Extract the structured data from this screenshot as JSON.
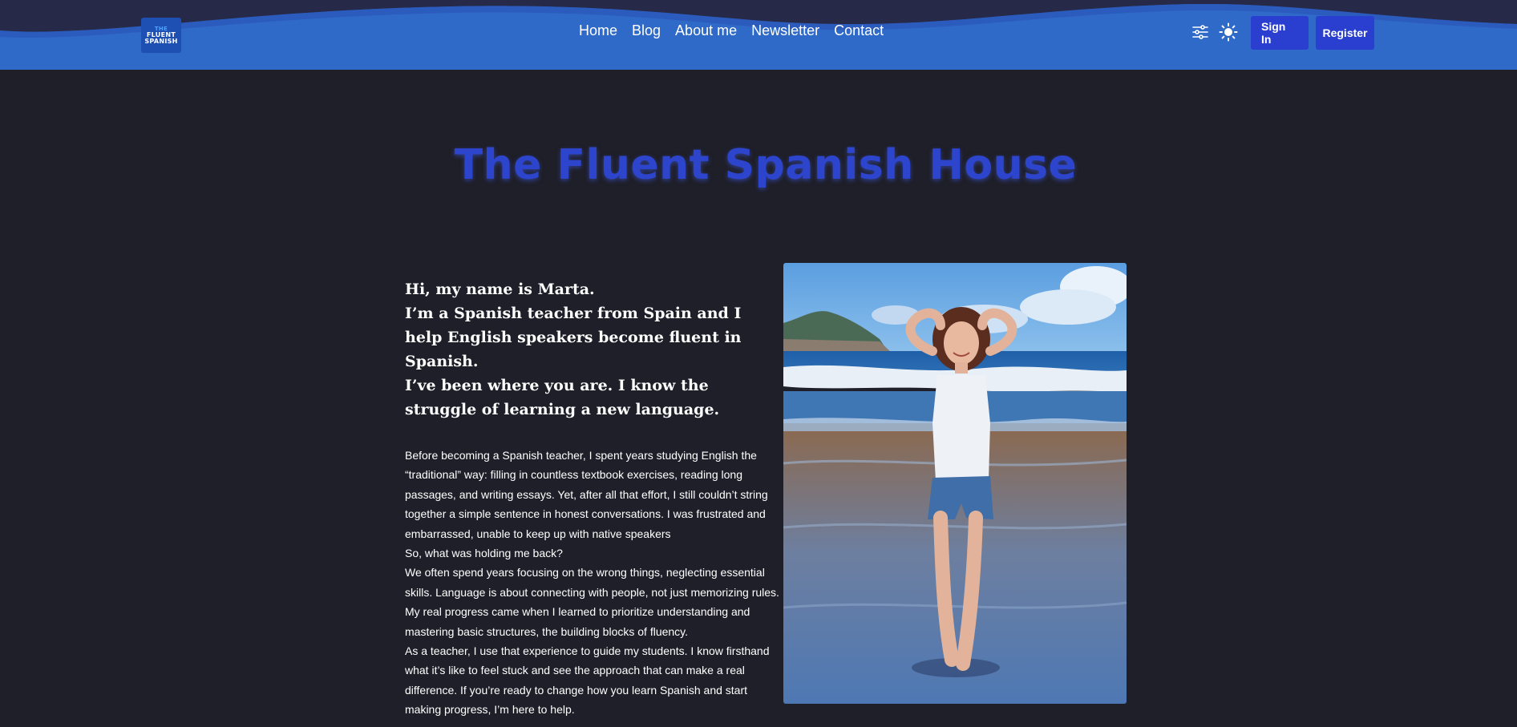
{
  "header": {
    "logo": {
      "line1": "THE",
      "line2": "FLUENT",
      "line3": "SPANISH"
    },
    "nav": [
      {
        "label": "Home"
      },
      {
        "label": "Blog"
      },
      {
        "label": "About me"
      },
      {
        "label": "Newsletter"
      },
      {
        "label": "Contact"
      }
    ],
    "icons": {
      "settings": "sliders-icon",
      "theme": "sun-icon"
    },
    "sign_in_label": "Sign In",
    "register_label": "Register"
  },
  "hero": {
    "title": "The Fluent Spanish House"
  },
  "intro": {
    "heading": [
      "Hi, my name is Marta.",
      "I’m a Spanish teacher from Spain and I help English speakers become fluent in Spanish.",
      "I’ve been where you are. I know the struggle of learning a new language."
    ],
    "paragraphs": [
      "Before becoming a Spanish teacher, I spent years studying English the “traditional” way: filling in countless textbook exercises, reading long passages, and writing essays. Yet, after all that effort, I still couldn’t string together a simple sentence in honest conversations. I was frustrated and embarrassed, unable to keep up with native speakers",
      "So, what was holding me back?",
      "We often spend years focusing on the wrong things, neglecting essential skills. Language is about connecting with people, not just memorizing rules. My real progress came when I learned to prioritize understanding and mastering basic structures, the building blocks of fluency.",
      "As a teacher, I use that experience to guide my students. I know firsthand what it’s like to feel stuck and see the approach that can make a real difference. If you’re ready to change how you learn Spanish and start making progress, I’m here to help."
    ]
  },
  "colors": {
    "background": "#1f1f29",
    "header": "#2f6ac9",
    "button": "#2a3fcf",
    "title": "#2d45cc"
  }
}
